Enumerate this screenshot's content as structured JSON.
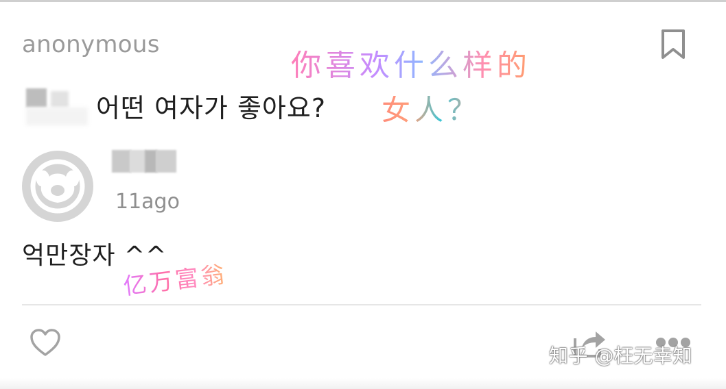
{
  "post": {
    "author": "anonymous",
    "question": "어떤 여자가 좋아요?",
    "bookmark_icon": "bookmark-icon"
  },
  "reply": {
    "avatar_icon": "default-avatar-icon",
    "time": "11ago",
    "text": "억만장자 ^^"
  },
  "actions": {
    "like_icon": "heart-icon",
    "share_icon": "share-icon",
    "more_icon": "more-icon"
  },
  "annotations": {
    "question_line1": "你喜欢什么样的",
    "question_line2": "女人？",
    "reply_line": "亿万富翁"
  },
  "watermark": "知乎 @枉无幸知",
  "colors": {
    "text": "#1f1f1f",
    "muted": "#9a9a9a",
    "icon": "#a7a7a7",
    "avatar_bg": "#d5d5d5"
  }
}
